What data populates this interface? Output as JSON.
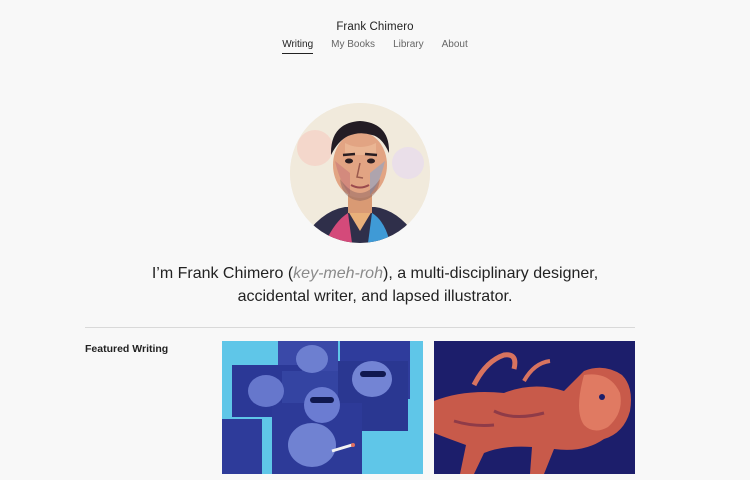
{
  "site": {
    "title": "Frank Chimero"
  },
  "nav": {
    "items": [
      {
        "label": "Writing",
        "active": true
      },
      {
        "label": "My Books",
        "active": false
      },
      {
        "label": "Library",
        "active": false
      },
      {
        "label": "About",
        "active": false
      }
    ]
  },
  "intro": {
    "before": "I’m Frank Chimero (",
    "pronunciation": "key-meh-roh",
    "after": "), a multi-disciplinary designer, accidental writer, and lapsed illustrator."
  },
  "featured": {
    "label": "Featured Writing",
    "items": [
      {
        "image": "blue-collage-portraits"
      },
      {
        "image": "orange-lion-sculpture"
      }
    ]
  },
  "colors": {
    "background": "#f8f8f8",
    "text": "#222222",
    "muted": "#8a8a8a",
    "thumb1_accent": "#5fc6e8",
    "thumb2_accent": "#1c1e6b"
  }
}
